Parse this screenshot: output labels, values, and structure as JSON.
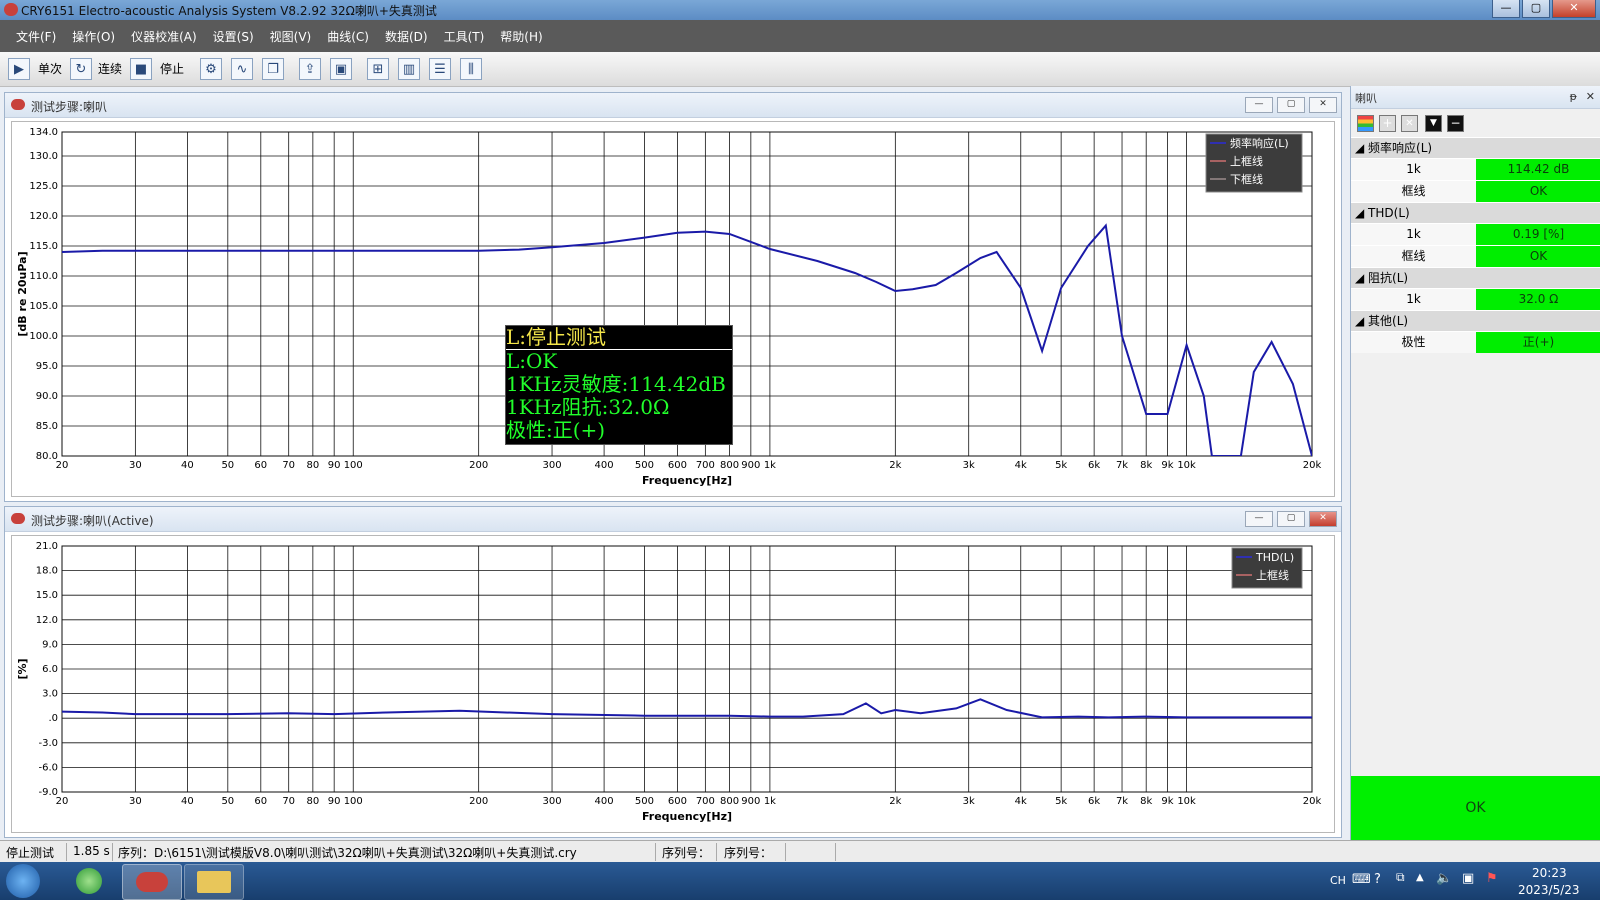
{
  "window": {
    "title": "CRY6151 Electro-acoustic Analysis System  V8.2.92 32Ω喇叭+失真测试",
    "min": "—",
    "max": "▢",
    "close": "✕"
  },
  "menu": [
    "文件(F)",
    "操作(O)",
    "仪器校准(A)",
    "设置(S)",
    "视图(V)",
    "曲线(C)",
    "数据(D)",
    "工具(T)",
    "帮助(H)"
  ],
  "toolbar": {
    "single": "单次",
    "continuous": "连续",
    "stop": "停止"
  },
  "panel_top": {
    "title": "测试步骤:喇叭"
  },
  "panel_bottom": {
    "title": "测试步骤:喇叭(Active)"
  },
  "overlay": {
    "title": "L:停止测试",
    "lines": [
      "L:OK",
      "1KHz灵敏度:114.42dB",
      "1KHz阻抗:32.0Ω",
      "极性:正(+)"
    ]
  },
  "chart_data": [
    {
      "type": "line",
      "xlabel": "Frequency[Hz]",
      "ylabel": "[dB re 20uPa]",
      "xscale": "log",
      "xlim": [
        20,
        20000
      ],
      "ylim": [
        80,
        134
      ],
      "x_tick_labels": [
        "20",
        "30",
        "40",
        "50",
        "60",
        "70",
        "80",
        "90",
        "100",
        "200",
        "300",
        "400",
        "500",
        "600",
        "700",
        "800",
        "900",
        "1k",
        "2k",
        "3k",
        "4k",
        "5k",
        "6k",
        "7k",
        "8k",
        "9k",
        "10k",
        "20k"
      ],
      "x_tick_values": [
        20,
        30,
        40,
        50,
        60,
        70,
        80,
        90,
        100,
        200,
        300,
        400,
        500,
        600,
        700,
        800,
        900,
        1000,
        2000,
        3000,
        4000,
        5000,
        6000,
        7000,
        8000,
        9000,
        10000,
        20000
      ],
      "y_tick_labels": [
        "80.0",
        "85.0",
        "90.0",
        "95.0",
        "100.0",
        "105.0",
        "110.0",
        "115.0",
        "120.0",
        "125.0",
        "130.0",
        "134.0"
      ],
      "y_tick_values": [
        80,
        85,
        90,
        95,
        100,
        105,
        110,
        115,
        120,
        125,
        130,
        134
      ],
      "legend": [
        "频率响应(L)",
        "上框线",
        "下框线"
      ],
      "legend_position": "top-right",
      "grid": true,
      "series": [
        {
          "name": "频率响应(L)",
          "color": "#1a1aa8",
          "x": [
            20,
            25,
            30,
            50,
            100,
            200,
            250,
            300,
            400,
            500,
            600,
            700,
            800,
            1000,
            1300,
            1600,
            1800,
            2000,
            2200,
            2500,
            2800,
            3200,
            3500,
            4000,
            4500,
            5000,
            5800,
            6400,
            7000,
            8000,
            9000,
            10000,
            11000,
            11500,
            13500,
            14500,
            16000,
            18000,
            20000
          ],
          "y": [
            114,
            114.2,
            114.2,
            114.2,
            114.2,
            114.2,
            114.4,
            114.8,
            115.5,
            116.4,
            117.2,
            117.4,
            117,
            114.5,
            112.5,
            110.5,
            109,
            107.5,
            107.8,
            108.5,
            110.5,
            113,
            114,
            108,
            97.5,
            108,
            115,
            118.4,
            100,
            87,
            87,
            98.5,
            90,
            80,
            80,
            94,
            99,
            92,
            80
          ]
        }
      ]
    },
    {
      "type": "line",
      "xlabel": "Frequency[Hz]",
      "ylabel": "[%]",
      "xscale": "log",
      "xlim": [
        20,
        20000
      ],
      "ylim": [
        -9,
        21
      ],
      "x_tick_labels": [
        "20",
        "30",
        "40",
        "50",
        "60",
        "70",
        "80",
        "90",
        "100",
        "200",
        "300",
        "400",
        "500",
        "600",
        "700",
        "800",
        "900",
        "1k",
        "2k",
        "3k",
        "4k",
        "5k",
        "6k",
        "7k",
        "8k",
        "9k",
        "10k",
        "20k"
      ],
      "x_tick_values": [
        20,
        30,
        40,
        50,
        60,
        70,
        80,
        90,
        100,
        200,
        300,
        400,
        500,
        600,
        700,
        800,
        900,
        1000,
        2000,
        3000,
        4000,
        5000,
        6000,
        7000,
        8000,
        9000,
        10000,
        20000
      ],
      "y_tick_labels": [
        "-9.0",
        "-6.0",
        "-3.0",
        ".0",
        "3.0",
        "6.0",
        "9.0",
        "12.0",
        "15.0",
        "18.0",
        "21.0"
      ],
      "y_tick_values": [
        -9,
        -6,
        -3,
        0,
        3,
        6,
        9,
        12,
        15,
        18,
        21
      ],
      "legend": [
        "THD(L)",
        "上框线"
      ],
      "legend_position": "top-right",
      "grid": true,
      "series": [
        {
          "name": "THD(L)",
          "color": "#1a1aa8",
          "x": [
            20,
            25,
            30,
            50,
            70,
            90,
            120,
            180,
            300,
            500,
            800,
            1000,
            1200,
            1500,
            1700,
            1850,
            2000,
            2300,
            2800,
            3200,
            3700,
            4500,
            5500,
            6500,
            8000,
            10000,
            20000
          ],
          "y": [
            0.8,
            0.7,
            0.5,
            0.5,
            0.6,
            0.5,
            0.7,
            0.9,
            0.5,
            0.3,
            0.3,
            0.2,
            0.2,
            0.5,
            1.8,
            0.6,
            1,
            0.6,
            1.2,
            2.3,
            1,
            0.1,
            0.2,
            0.1,
            0.2,
            0.1,
            0.1
          ]
        }
      ]
    }
  ],
  "side": {
    "title": "喇叭",
    "pin": "ᵽ",
    "close": "✕",
    "groups": [
      {
        "name": "频率响应(L)",
        "rows": [
          {
            "k": "1k",
            "v": "114.42 dB"
          },
          {
            "k": "框线",
            "v": "OK"
          }
        ]
      },
      {
        "name": "THD(L)",
        "rows": [
          {
            "k": "1k",
            "v": "0.19 [%]"
          },
          {
            "k": "框线",
            "v": "OK"
          }
        ]
      },
      {
        "name": "阻抗(L)",
        "rows": [
          {
            "k": "1k",
            "v": "32.0 Ω"
          }
        ]
      },
      {
        "name": "其他(L)",
        "rows": [
          {
            "k": "极性",
            "v": "正(+)"
          }
        ]
      }
    ],
    "result": "OK",
    "colors": {
      "pass": "#00ee00"
    }
  },
  "status": {
    "state": "停止测试",
    "time": "1.85 s",
    "sequence": "序列：D:\\6151\\测试模版V8.0\\喇叭测试\\32Ω喇叭+失真测试\\32Ω喇叭+失真测试.cry",
    "serial1": "序列号：",
    "serial2": "序列号："
  },
  "taskbar": {
    "lang": "CH",
    "time": "20:23",
    "date": "2023/5/23"
  }
}
